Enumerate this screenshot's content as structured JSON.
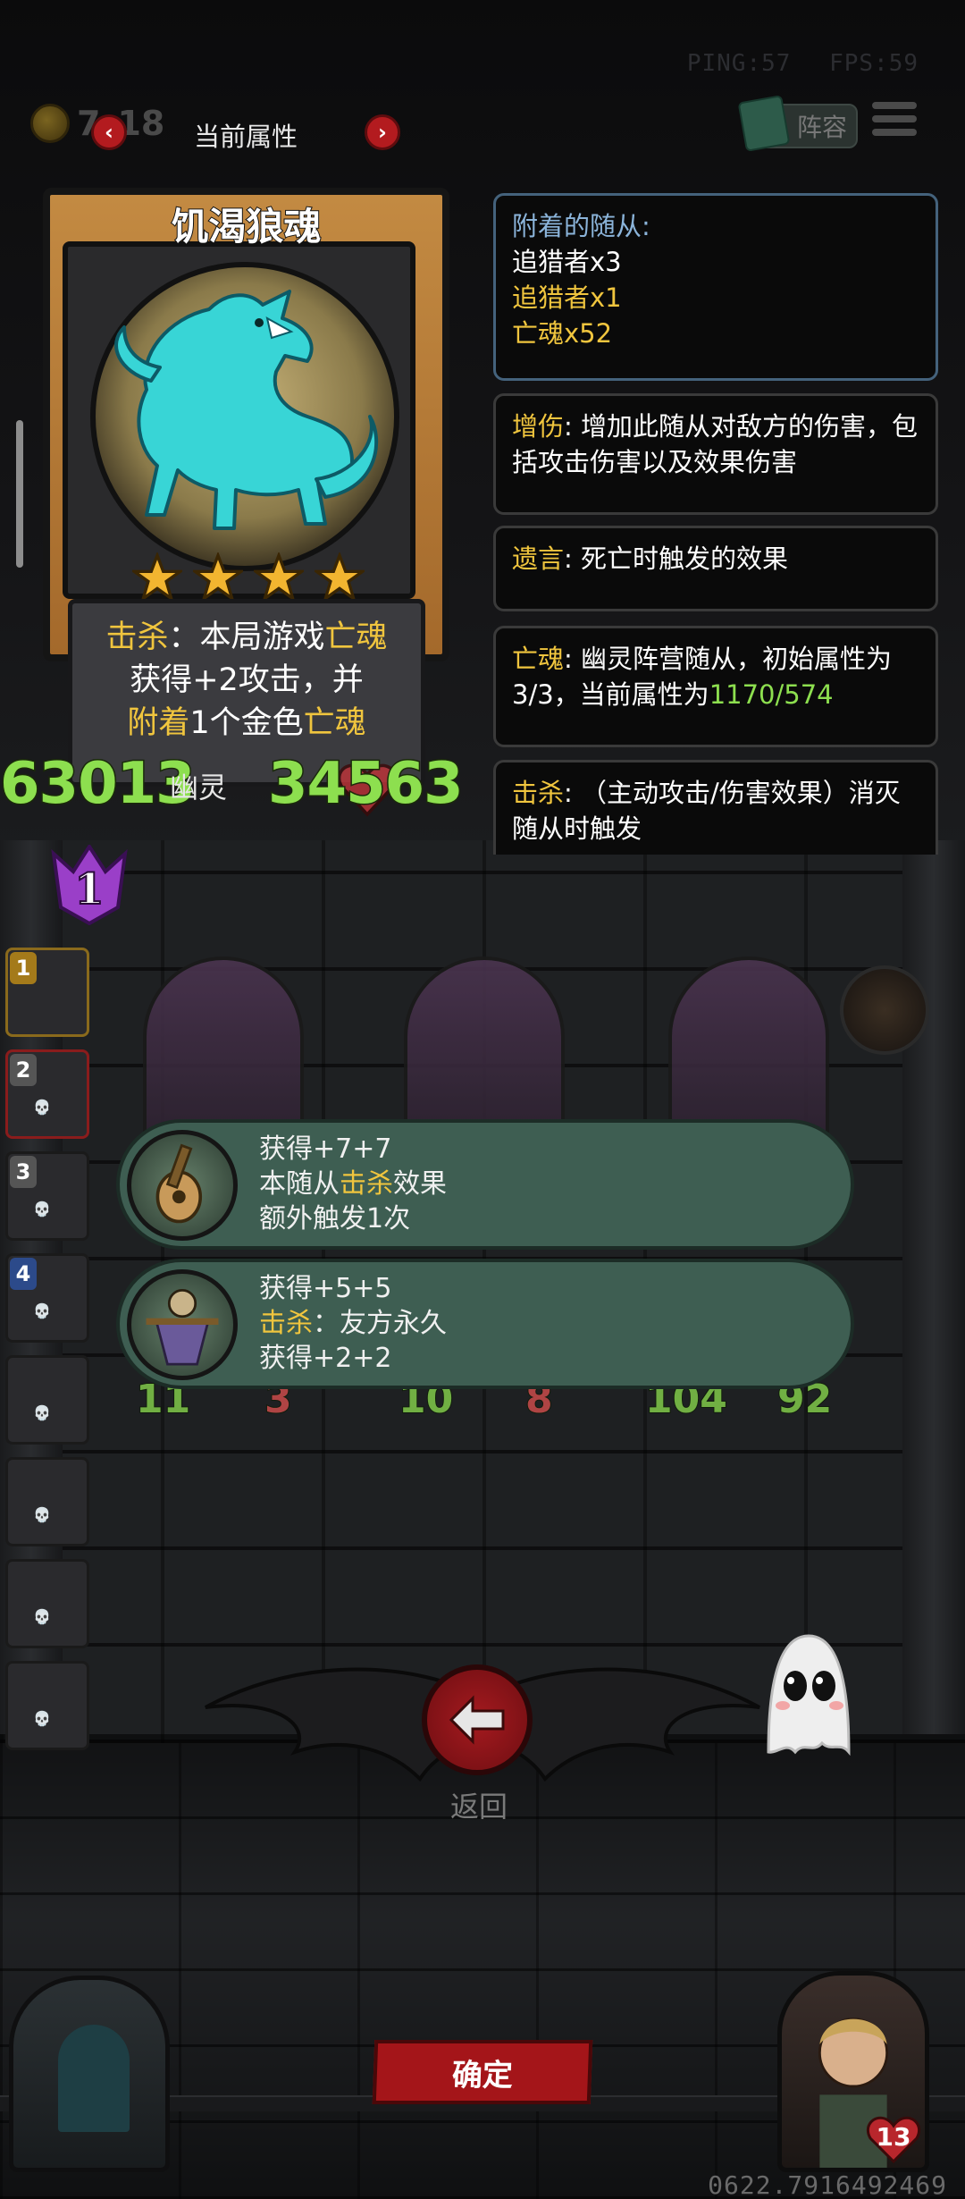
{
  "hud": {
    "ping": "PING:57",
    "fps": "FPS:59",
    "gold": "7_18"
  },
  "header": {
    "title": "当前属性",
    "prev_icon": "chevron-left-icon",
    "next_icon": "chevron-right-icon",
    "lineup_label": "阵容"
  },
  "card": {
    "name": "饥渴狼魂",
    "stars": 4,
    "text_line1_kw": "击杀",
    "text_line1_mid": "：本局游戏",
    "text_line1_kw2": "亡魂",
    "text_line2": "获得+2攻击，并",
    "text_line3_kw": "附着",
    "text_line3_mid": "1个金色",
    "text_line3_kw2": "亡魂",
    "attack": "63013",
    "type": "幽灵",
    "health": "34563",
    "tier": "1"
  },
  "info": {
    "attached_title": "附着的随从:",
    "attached_items": [
      {
        "text": "追猎者x3",
        "color": "#ffffff"
      },
      {
        "text": "追猎者x1",
        "color": "#f0c53e"
      },
      {
        "text": "亡魂x52",
        "color": "#f0c53e"
      }
    ],
    "kw1": "增伤",
    "kw1_desc": ": 增加此随从对敌方的伤害，包括攻击伤害以及效果伤害",
    "kw2": "遗言",
    "kw2_desc": ": 死亡时触发的效果",
    "kw3": "亡魂",
    "kw3_desc": ": 幽灵阵营随从，初始属性为3/3，当前属性为",
    "kw3_value": "1170/574",
    "kw4": "击杀",
    "kw4_desc": ": （主动攻击/伤害效果）消灭随从时触发"
  },
  "hand_slots": [
    "1",
    "2",
    "3",
    "4",
    "",
    "",
    "",
    ""
  ],
  "board_stats": [
    "11",
    "3",
    "10",
    "8",
    "104",
    "92"
  ],
  "tooltips": [
    {
      "line1": "获得+7+7",
      "line2_pre": "本随从",
      "line2_kw": "击杀",
      "line2_post": "效果",
      "line3": "额外触发1次"
    },
    {
      "line1": "获得+5+5",
      "line2_kw": "击杀",
      "line2_post": "：友方永久",
      "line3": "获得+2+2"
    }
  ],
  "back": {
    "label": "返回"
  },
  "confirm": {
    "label": "确定"
  },
  "hero": {
    "health": "13"
  },
  "version": "0622.7916492469",
  "colors": {
    "accent_gold": "#f0c53e",
    "stat_green": "#8ddf4f",
    "button_red": "#a41519",
    "tooltip_bg": "#3e5e52"
  }
}
